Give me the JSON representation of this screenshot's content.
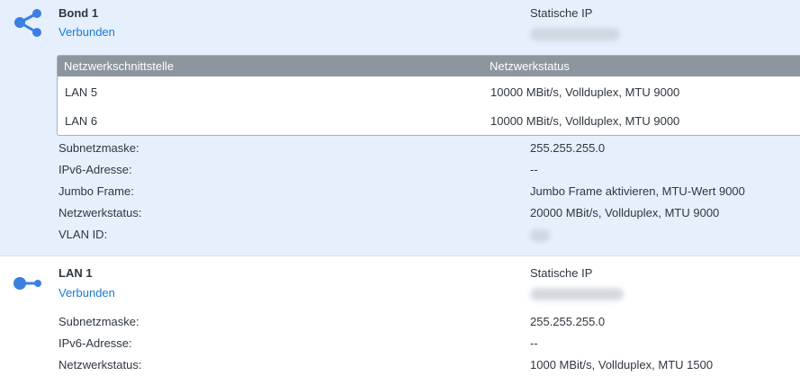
{
  "bond": {
    "icon": "share-icon",
    "name": "Bond 1",
    "status": "Verbunden",
    "ip_type": "Statische IP",
    "table": {
      "headers": [
        "Netzwerkschnittstelle",
        "Netzwerkstatus"
      ],
      "rows": [
        {
          "interface": "LAN 5",
          "status": "10000 MBit/s, Vollduplex, MTU 9000"
        },
        {
          "interface": "LAN 6",
          "status": "10000 MBit/s, Vollduplex, MTU 9000"
        }
      ]
    },
    "details": [
      {
        "label": "Subnetzmaske:",
        "value": "255.255.255.0"
      },
      {
        "label": "IPv6-Adresse:",
        "value": "--"
      },
      {
        "label": "Jumbo Frame:",
        "value": "Jumbo Frame aktivieren, MTU-Wert 9000"
      },
      {
        "label": "Netzwerkstatus:",
        "value": "20000 MBit/s, Vollduplex, MTU 9000"
      },
      {
        "label": "VLAN ID:",
        "value": ""
      }
    ]
  },
  "lan1": {
    "icon": "network-port-icon",
    "name": "LAN 1",
    "status": "Verbunden",
    "ip_type": "Statische IP",
    "details": [
      {
        "label": "Subnetzmaske:",
        "value": "255.255.255.0"
      },
      {
        "label": "IPv6-Adresse:",
        "value": "--"
      },
      {
        "label": "Netzwerkstatus:",
        "value": "1000 MBit/s, Vollduplex, MTU 1500"
      }
    ]
  },
  "colors": {
    "accent": "#1a78d6",
    "icon": "#3b7fe0",
    "bond_bg": "#e6f0fc",
    "table_header": "#8d969f"
  }
}
